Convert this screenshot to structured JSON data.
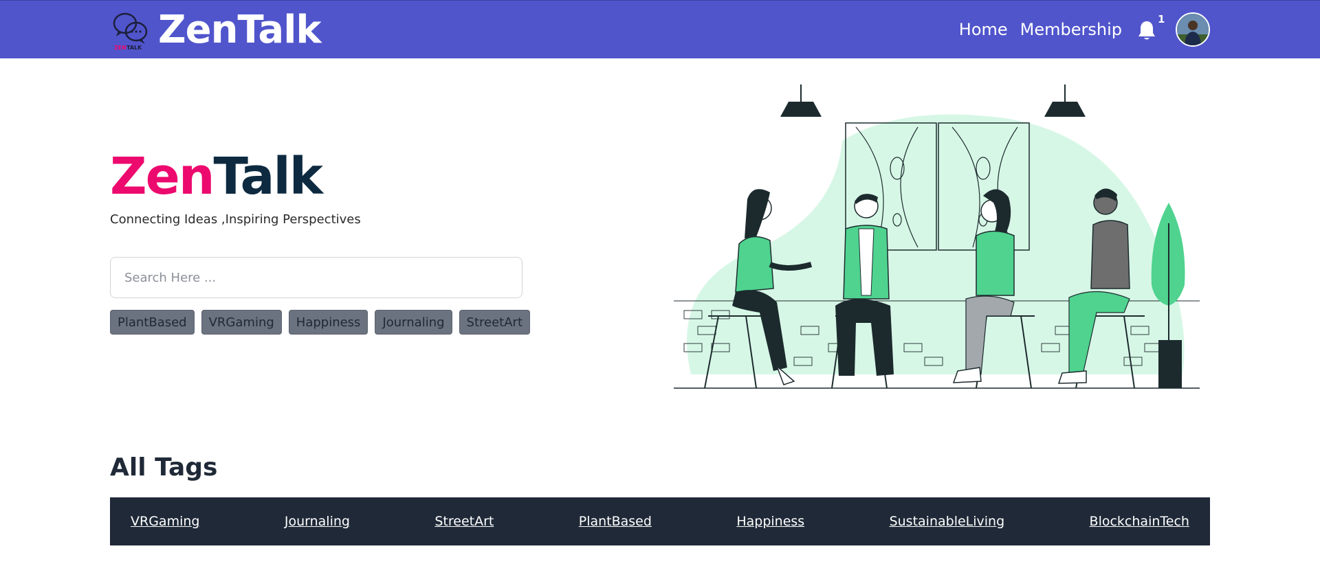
{
  "navbar": {
    "brand_name": "ZenTalk",
    "logo_text_zen": "ZEN",
    "logo_text_talk": "TALK",
    "links": [
      {
        "label": "Home"
      },
      {
        "label": "Membership"
      }
    ],
    "notification_count": "1",
    "colors": {
      "background": "#5055cc",
      "text": "#ffffff"
    }
  },
  "hero": {
    "title_part1": "Zen",
    "title_part2": "Talk",
    "subtitle": "Connecting Ideas ,Inspiring Perspectives",
    "search_placeholder": "Search Here ...",
    "search_value": "",
    "chips": [
      "PlantBased",
      "VRGaming",
      "Happiness",
      "Journaling",
      "StreetArt"
    ],
    "colors": {
      "zen": "#ec0a6e",
      "talk": "#0d2a40"
    }
  },
  "all_tags": {
    "heading": "All Tags",
    "tags": [
      "VRGaming",
      "Journaling",
      "StreetArt",
      "PlantBased",
      "Happiness",
      "SustainableLiving",
      "BlockchainTech"
    ],
    "colors": {
      "bar_background": "#1f2937",
      "link": "#ffffff"
    }
  },
  "icons": {
    "notification": "bell-icon",
    "avatar": "user-avatar",
    "logo": "chat-bubbles-logo"
  }
}
